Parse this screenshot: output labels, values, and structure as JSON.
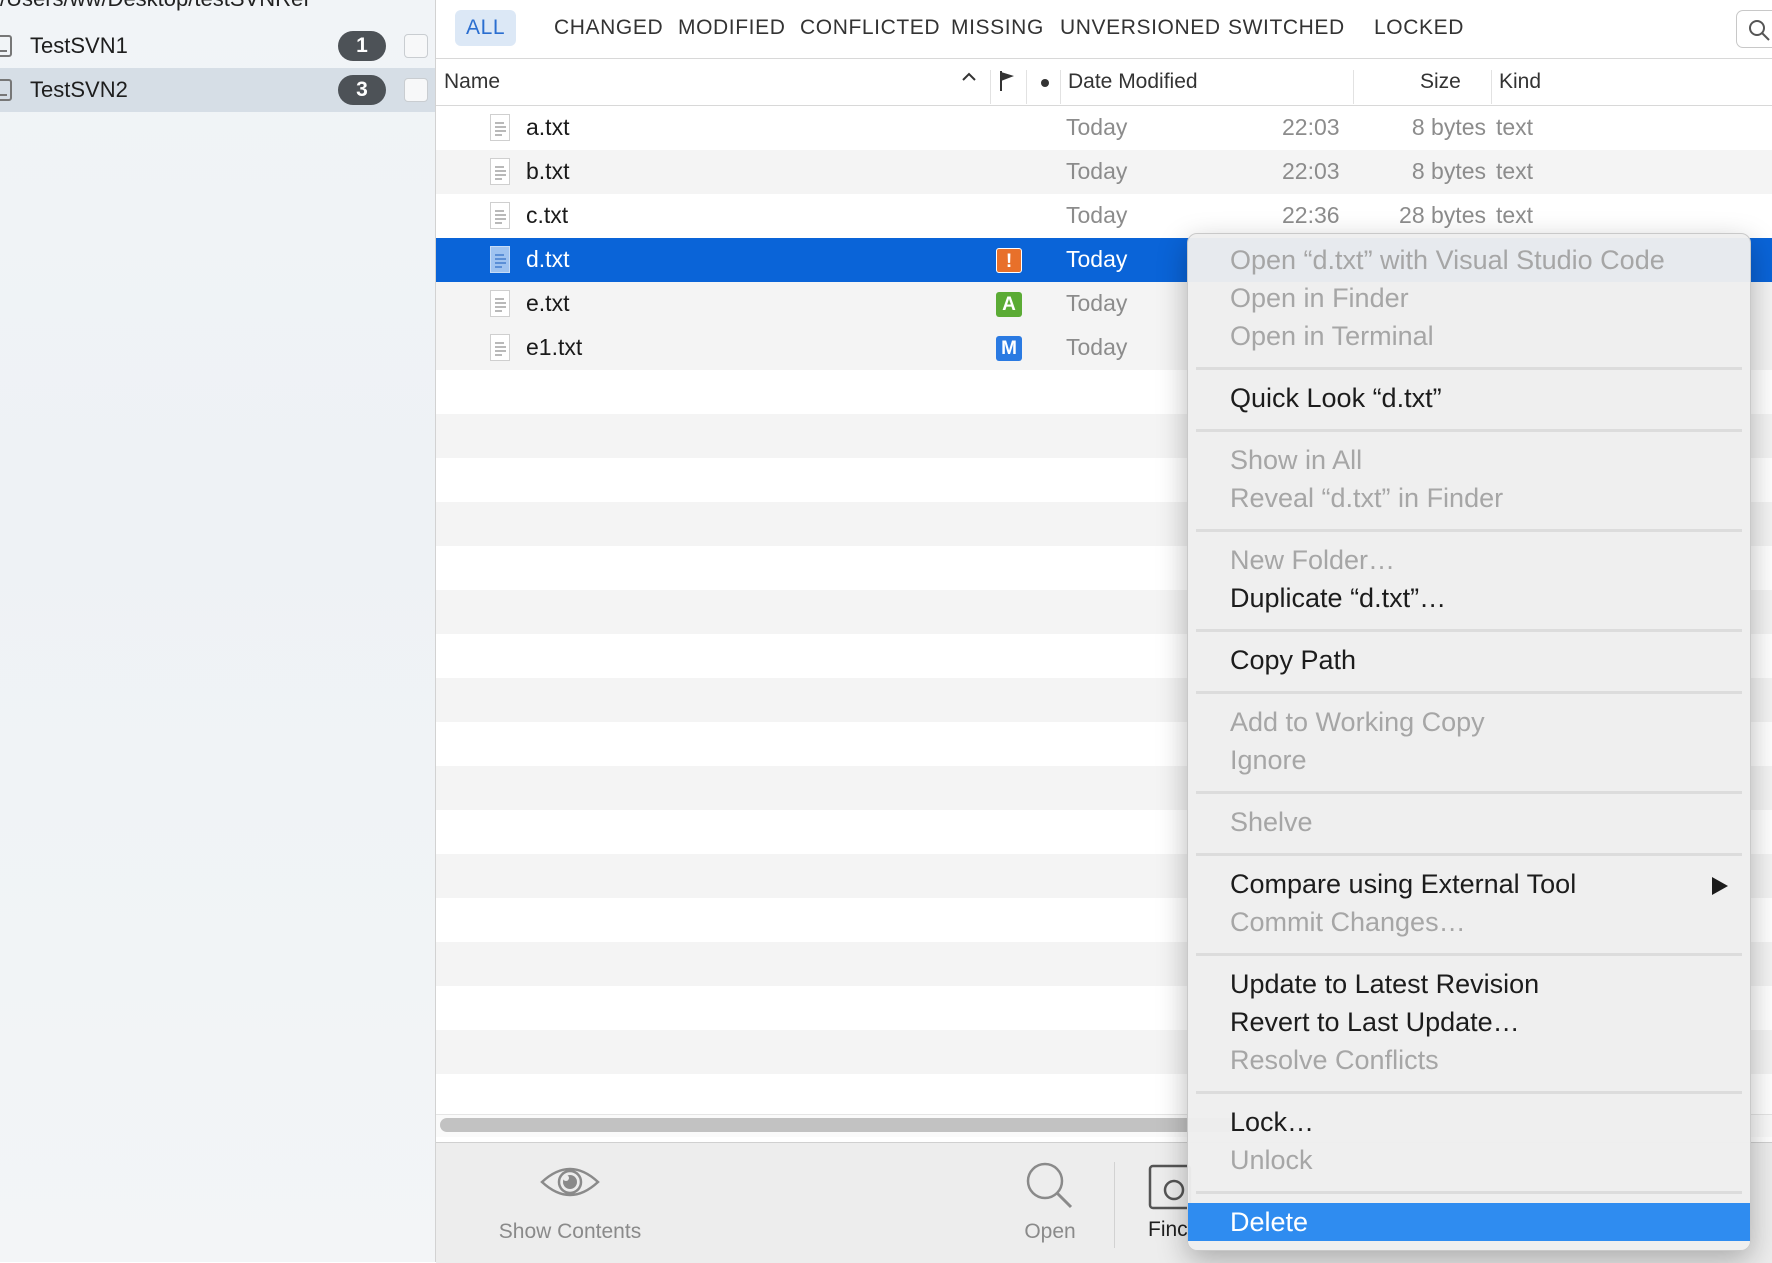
{
  "sidebar": {
    "path": "/Users/ww/Desktop/testSVNRef",
    "repos": [
      {
        "name": "TestSVN1",
        "count": "1"
      },
      {
        "name": "TestSVN2",
        "count": "3"
      }
    ]
  },
  "tabs": [
    "ALL",
    "CHANGED",
    "MODIFIED",
    "CONFLICTED",
    "MISSING",
    "UNVERSIONED",
    "SWITCHED",
    "LOCKED"
  ],
  "columns": {
    "name": "Name",
    "date": "Date Modified",
    "size": "Size",
    "kind": "Kind"
  },
  "files": [
    {
      "name": "a.txt",
      "status": "",
      "date": "Today",
      "time": "22:03",
      "size": "8 bytes",
      "kind": "text"
    },
    {
      "name": "b.txt",
      "status": "",
      "date": "Today",
      "time": "22:03",
      "size": "8 bytes",
      "kind": "text"
    },
    {
      "name": "c.txt",
      "status": "",
      "date": "Today",
      "time": "22:36",
      "size": "28 bytes",
      "kind": "text"
    },
    {
      "name": "d.txt",
      "status": "!",
      "status_color": "#e8702a",
      "date": "Today",
      "time": "",
      "size": "",
      "kind": ""
    },
    {
      "name": "e.txt",
      "status": "A",
      "status_color": "#5bab35",
      "date": "Today",
      "time": "",
      "size": "",
      "kind": ""
    },
    {
      "name": "e1.txt",
      "status": "M",
      "status_color": "#2a7ae2",
      "date": "Today",
      "time": "",
      "size": "",
      "kind": ""
    }
  ],
  "toolbar": {
    "show_contents": "Show Contents",
    "open": "Open",
    "find": "Finc"
  },
  "menu": {
    "open_with": "Open “d.txt” with Visual Studio Code",
    "open_finder": "Open in Finder",
    "open_terminal": "Open in Terminal",
    "quick_look": "Quick Look “d.txt”",
    "show_in_all": "Show in All",
    "reveal": "Reveal “d.txt” in Finder",
    "new_folder": "New Folder…",
    "duplicate": "Duplicate “d.txt”…",
    "copy_path": "Copy Path",
    "add_to_wc": "Add to Working Copy",
    "ignore": "Ignore",
    "shelve": "Shelve",
    "compare": "Compare using External Tool",
    "commit": "Commit Changes…",
    "update": "Update to Latest Revision",
    "revert": "Revert to Last Update…",
    "resolve": "Resolve Conflicts",
    "lock": "Lock…",
    "unlock": "Unlock",
    "delete": "Delete"
  },
  "colors": {
    "selection": "#0a64d8",
    "menu_highlight": "#2f8cf0",
    "tab_active": "#2a6ed0"
  }
}
